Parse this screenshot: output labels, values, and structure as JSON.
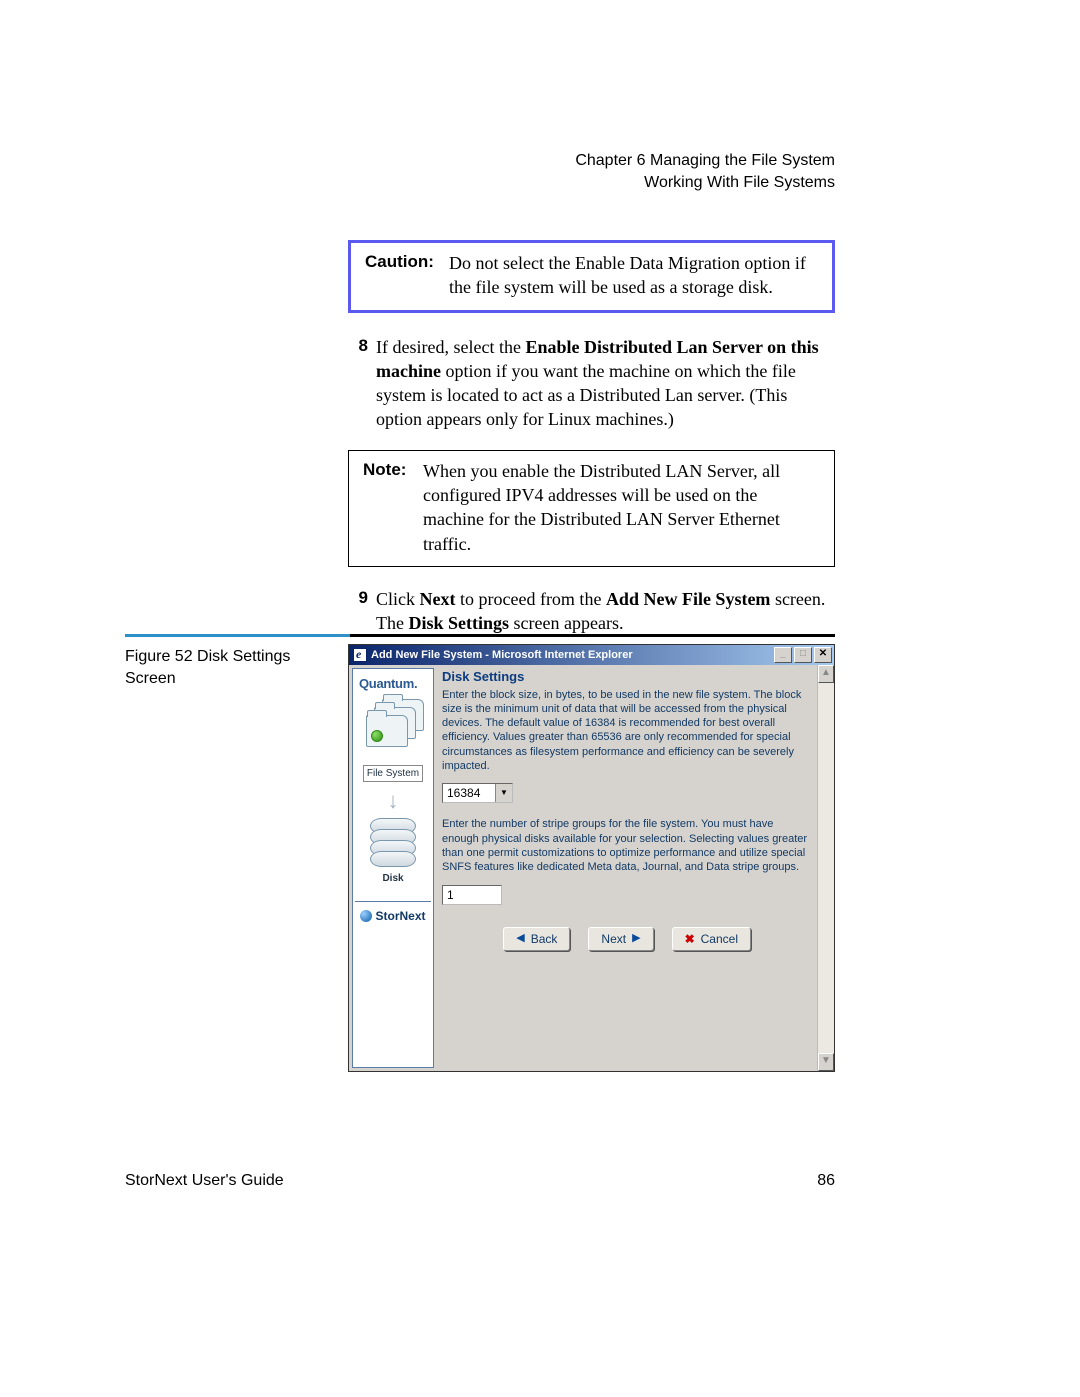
{
  "header": {
    "chapter_line": "Chapter 6  Managing the File System",
    "section_line": "Working With File Systems"
  },
  "caution": {
    "label": "Caution:",
    "text": "Do not select the Enable Data Migration option if the file system will be used as a storage disk."
  },
  "step8": {
    "num": "8",
    "lead": "If desired, select the ",
    "bold1": "Enable Distributed Lan Server on this machine",
    "rest": " option if you want the machine on which the file system is located to act as a Distributed Lan server. (This option appears only for Linux machines.)"
  },
  "note": {
    "label": "Note:",
    "text": "When you enable the Distributed LAN Server, all configured IPV4 addresses will be used on the machine for the Distributed LAN Server Ethernet traffic."
  },
  "step9": {
    "num": "9",
    "lead": "Click ",
    "bold1": "Next",
    "mid": " to proceed from the ",
    "bold2": "Add New File System",
    "mid2": " screen. The ",
    "bold3": "Disk Settings",
    "rest": " screen appears."
  },
  "figure": {
    "caption": "Figure 52  Disk Settings Screen"
  },
  "window": {
    "title": "Add New File System - Microsoft Internet Explorer",
    "controls": {
      "min": "_",
      "max": "□",
      "close": "✕"
    }
  },
  "sidebar": {
    "brand": "Quantum.",
    "fs_label": "File System",
    "disk_label": "Disk",
    "product": "StorNext"
  },
  "dialog": {
    "heading": "Disk Settings",
    "para1": "Enter the block size, in bytes, to be used in the new file system. The block size is the minimum unit of data that will be accessed from the physical devices. The default value of 16384 is recommended for best overall efficiency. Values greater than 65536 are only recommended for special circumstances as filesystem performance and efficiency can be severely impacted.",
    "block_size_value": "16384",
    "para2": "Enter the number of stripe groups for the file system. You must have enough physical disks available for your selection. Selecting values greater than one permit customizations to optimize performance and utilize special SNFS features like dedicated Meta data, Journal, and Data stripe groups.",
    "stripe_groups_value": "1",
    "buttons": {
      "back": "Back",
      "next": "Next",
      "cancel": "Cancel"
    }
  },
  "footer": {
    "guide": "StorNext User's Guide",
    "page": "86"
  }
}
